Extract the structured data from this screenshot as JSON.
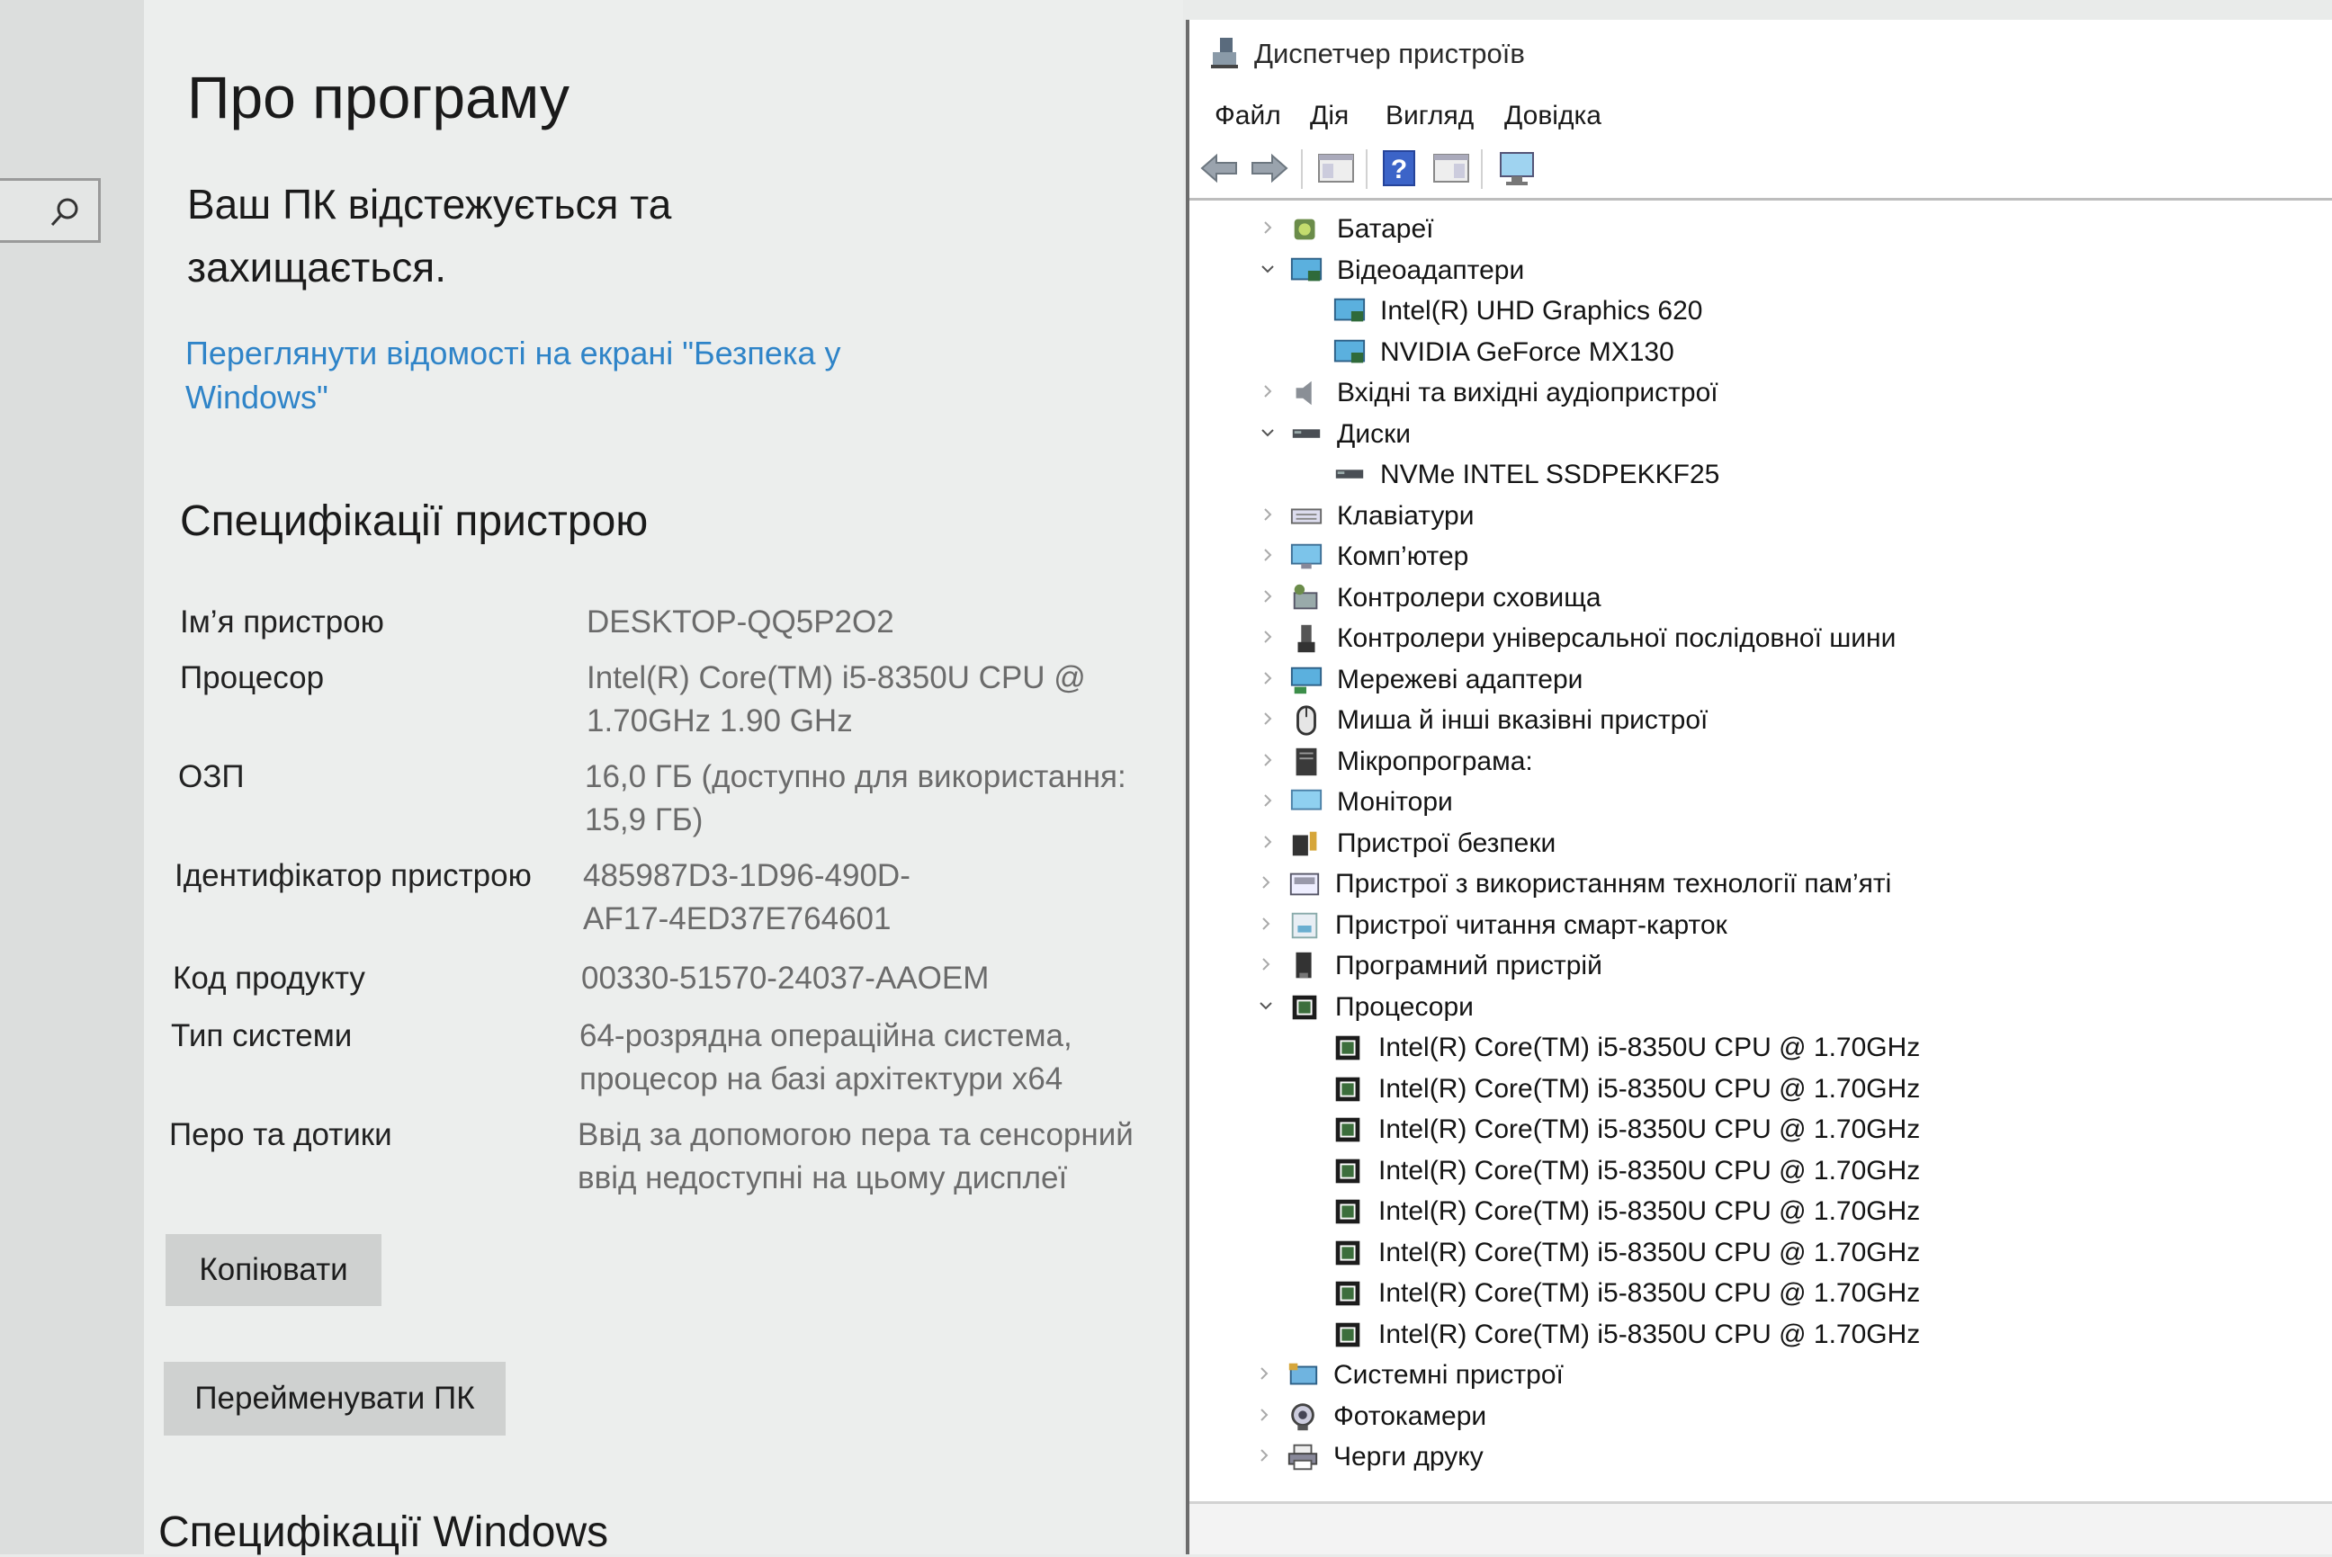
{
  "settings": {
    "page_title": "Про програму",
    "protection_text": "Ваш ПК відстежується та захищається.",
    "security_link": "Переглянути відомості на екрані \"Безпека у Windows\"",
    "device_specs_title": "Специфікації пристрою",
    "specs": [
      {
        "label": "Ім’я пристрою",
        "value": "DESKTOP-QQ5P2O2"
      },
      {
        "label": "Процесор",
        "value": "Intel(R) Core(TM) i5-8350U CPU @ 1.70GHz   1.90 GHz"
      },
      {
        "label": "ОЗП",
        "value": "16,0 ГБ (доступно для використання: 15,9 ГБ)"
      },
      {
        "label": "Ідентифікатор пристрою",
        "value": "485987D3-1D96-490D-AF17-4ED37E764601"
      },
      {
        "label": "Код продукту",
        "value": "00330-51570-24037-AAOEM"
      },
      {
        "label": "Тип системи",
        "value": "64-розрядна операційна система, процесор на базі архітектури x64"
      },
      {
        "label": "Перо та дотики",
        "value": "Ввід за допомогою пера та сенсорний ввід недоступні на цьому дисплеї"
      }
    ],
    "copy_button": "Копіювати",
    "rename_button": "Перейменувати ПК",
    "windows_specs_title": "Специфікації Windows"
  },
  "device_manager": {
    "title": "Диспетчер пристроїв",
    "menu": [
      "Файл",
      "Дія",
      "Вигляд",
      "Довідка"
    ],
    "tree": [
      {
        "label": "Батареї",
        "icon": "battery-icon",
        "expanded": false,
        "child": false
      },
      {
        "label": "Відеоадаптери",
        "icon": "display-adapter-icon",
        "expanded": true,
        "child": false
      },
      {
        "label": "Intel(R) UHD Graphics 620",
        "icon": "display-adapter-icon",
        "child": true
      },
      {
        "label": "NVIDIA GeForce MX130",
        "icon": "display-adapter-icon",
        "child": true
      },
      {
        "label": "Вхідні та вихідні аудіопристрої",
        "icon": "speaker-icon",
        "expanded": false,
        "child": false
      },
      {
        "label": "Диски",
        "icon": "disk-drive-icon",
        "expanded": true,
        "child": false
      },
      {
        "label": "NVMe INTEL SSDPEKKF25",
        "icon": "disk-drive-icon",
        "child": true
      },
      {
        "label": "Клавіатури",
        "icon": "keyboard-icon",
        "expanded": false,
        "child": false
      },
      {
        "label": "Комп’ютер",
        "icon": "computer-icon",
        "expanded": false,
        "child": false
      },
      {
        "label": "Контролери сховища",
        "icon": "storage-controller-icon",
        "expanded": false,
        "child": false
      },
      {
        "label": "Контролери універсальної послідовної шини",
        "icon": "usb-icon",
        "expanded": false,
        "child": false
      },
      {
        "label": "Мережеві адаптери",
        "icon": "network-adapter-icon",
        "expanded": false,
        "child": false
      },
      {
        "label": "Миша й інші вказівні пристрої",
        "icon": "mouse-icon",
        "expanded": false,
        "child": false
      },
      {
        "label": "Мікропрограма:",
        "icon": "firmware-icon",
        "expanded": false,
        "child": false
      },
      {
        "label": "Монітори",
        "icon": "monitor-icon",
        "expanded": false,
        "child": false
      },
      {
        "label": "Пристрої безпеки",
        "icon": "security-device-icon",
        "expanded": false,
        "child": false
      },
      {
        "label": "Пристрої з використанням технології пам’яті",
        "icon": "memory-device-icon",
        "expanded": false,
        "child": false
      },
      {
        "label": "Пристрої читання смарт-карток",
        "icon": "smart-card-reader-icon",
        "expanded": false,
        "child": false
      },
      {
        "label": "Програмний пристрій",
        "icon": "software-device-icon",
        "expanded": false,
        "child": false
      },
      {
        "label": "Процесори",
        "icon": "processor-icon",
        "expanded": true,
        "child": false
      },
      {
        "label": "Intel(R) Core(TM) i5-8350U CPU @ 1.70GHz",
        "icon": "processor-icon",
        "child": true
      },
      {
        "label": "Intel(R) Core(TM) i5-8350U CPU @ 1.70GHz",
        "icon": "processor-icon",
        "child": true
      },
      {
        "label": "Intel(R) Core(TM) i5-8350U CPU @ 1.70GHz",
        "icon": "processor-icon",
        "child": true
      },
      {
        "label": "Intel(R) Core(TM) i5-8350U CPU @ 1.70GHz",
        "icon": "processor-icon",
        "child": true
      },
      {
        "label": "Intel(R) Core(TM) i5-8350U CPU @ 1.70GHz",
        "icon": "processor-icon",
        "child": true
      },
      {
        "label": "Intel(R) Core(TM) i5-8350U CPU @ 1.70GHz",
        "icon": "processor-icon",
        "child": true
      },
      {
        "label": "Intel(R) Core(TM) i5-8350U CPU @ 1.70GHz",
        "icon": "processor-icon",
        "child": true
      },
      {
        "label": "Intel(R) Core(TM) i5-8350U CPU @ 1.70GHz",
        "icon": "processor-icon",
        "child": true
      },
      {
        "label": "Системні пристрої",
        "icon": "system-devices-icon",
        "expanded": false,
        "child": false
      },
      {
        "label": "Фотокамери",
        "icon": "camera-icon",
        "expanded": false,
        "child": false
      },
      {
        "label": "Черги друку",
        "icon": "printer-icon",
        "expanded": false,
        "child": false
      }
    ]
  },
  "colors": {
    "link": "#2f84c8",
    "value_text": "#6b6b6b",
    "button_bg": "#cfd1d0"
  }
}
